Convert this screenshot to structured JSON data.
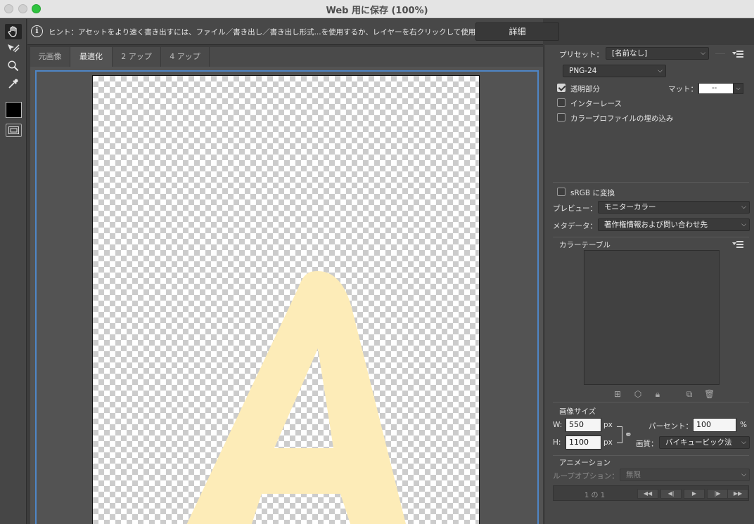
{
  "window": {
    "title": "Web 用に保存 (100%)"
  },
  "hint": {
    "text": "ヒント：アセットをより速く書き出すには、ファイル／書き出し／書き出し形式...を使用するか、レイヤーを右クリックして使用。",
    "details_label": "詳細"
  },
  "tabs": [
    {
      "label": "元画像",
      "active": false
    },
    {
      "label": "最適化",
      "active": true
    },
    {
      "label": "2 アップ",
      "active": false
    },
    {
      "label": "4 アップ",
      "active": false
    }
  ],
  "tools": [
    {
      "icon": "hand-icon",
      "active": true
    },
    {
      "icon": "slice-select-icon",
      "active": false
    },
    {
      "icon": "zoom-icon",
      "active": false
    },
    {
      "icon": "eyedropper-icon",
      "active": false
    }
  ],
  "eyedropper_color": "#000000",
  "canvas": {
    "letter_color": "#fdecb8",
    "frame_color": "#4f86c6"
  },
  "settings": {
    "preset_label": "プリセット：",
    "preset_value": "[名前なし]",
    "format_value": "PNG-24",
    "transparency_label": "透明部分",
    "transparency_checked": true,
    "matte_label": "マット：",
    "matte_value": "--",
    "interlace_label": "インターレース",
    "interlace_checked": false,
    "embed_profile_label": "カラープロファイルの埋め込み",
    "embed_profile_checked": false,
    "srgb_label": "sRGB に変換",
    "srgb_checked": false,
    "preview_label": "プレビュー：",
    "preview_value": "モニターカラー",
    "metadata_label": "メタデータ：",
    "metadata_value": "著作権情報および問い合わせ先"
  },
  "color_table": {
    "title": "カラーテーブル"
  },
  "image_size": {
    "title": "画像サイズ",
    "w_label": "W:",
    "w_value": "550",
    "h_label": "H:",
    "h_value": "1100",
    "unit_px": "px",
    "percent_label": "パーセント：",
    "percent_value": "100",
    "percent_unit": "%",
    "quality_label": "画質：",
    "quality_value": "バイキュービック法"
  },
  "animation": {
    "title": "アニメーション",
    "loop_label": "ループオプション：",
    "loop_value": "無限",
    "frame_counter": "1 の 1"
  }
}
